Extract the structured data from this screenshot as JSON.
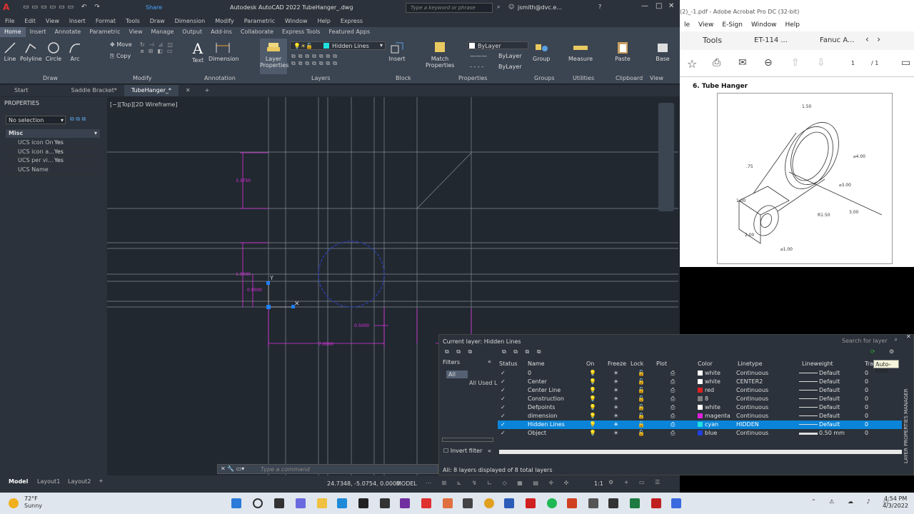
{
  "acad": {
    "title": "Autodesk AutoCAD 2022   TubeHanger_.dwg",
    "search_placeholder": "Type a keyword or phrase",
    "user": "jsmith@dvc.e...",
    "share": "Share",
    "menus": [
      "File",
      "Edit",
      "View",
      "Insert",
      "Format",
      "Tools",
      "Draw",
      "Dimension",
      "Modify",
      "Parametric",
      "Window",
      "Help",
      "Express"
    ],
    "ribbon_tabs": [
      "Home",
      "Insert",
      "Annotate",
      "Parametric",
      "View",
      "Manage",
      "Output",
      "Add-ins",
      "Collaborate",
      "Express Tools",
      "Featured Apps"
    ],
    "draw_tools": [
      "Line",
      "Polyline",
      "Circle",
      "Arc"
    ],
    "modify_tools": [
      "Move",
      "Copy"
    ],
    "annot_tools": [
      "Text",
      "Dimension"
    ],
    "layer_tool": "Layer\nProperties",
    "layer_current": "Hidden Lines",
    "insert_tool": "Insert",
    "match_tool": "Match\nProperties",
    "bylayer": [
      "ByLayer",
      "ByLayer",
      "ByLayer"
    ],
    "group_tool": "Group",
    "measure_tool": "Measure",
    "paste_tool": "Paste",
    "base_tool": "Base",
    "panels": [
      "Draw",
      "Modify",
      "Annotation",
      "Layers",
      "Block",
      "Properties",
      "Groups",
      "Utilities",
      "Clipboard",
      "View"
    ],
    "doc_tabs": [
      "Start",
      "Saddle Bracket*",
      "TubeHanger_*"
    ],
    "viewport_label": "[−][Top][2D Wireframe]",
    "properties": {
      "title": "PROPERTIES",
      "selection": "No selection",
      "section": "Misc",
      "rows": [
        {
          "k": "UCS icon On",
          "v": "Yes"
        },
        {
          "k": "UCS icon a...",
          "v": "Yes"
        },
        {
          "k": "UCS per vi...",
          "v": "Yes"
        },
        {
          "k": "UCS Name",
          "v": ""
        }
      ]
    },
    "dims": [
      "3.3750",
      "1.0000",
      "0.0000",
      "0.5000",
      "7.0000"
    ],
    "command_placeholder": "Type a command",
    "layout_tabs": [
      "Model",
      "Layout1",
      "Layout2"
    ],
    "coords": "24.7348, -5.0754, 0.0000",
    "model": "MODEL",
    "scale": "1:1"
  },
  "acrobat": {
    "title": "(2)_-1.pdf - Adobe Acrobat Pro DC (32-bit)",
    "menus": [
      "le",
      "View",
      "E-Sign",
      "Window",
      "Help"
    ],
    "tabs": [
      "Tools",
      "ET-114 ...",
      "Fanuc A..."
    ],
    "page": "1",
    "pages": "/ 1",
    "heading": "6.  Tube Hanger",
    "drawing_labels": [
      "1.50",
      "⌀4.00",
      "⌀3.00",
      "R1.50",
      "3.00",
      "1.00",
      "2.00",
      "⌀1.00",
      ".75"
    ]
  },
  "lpm": {
    "current_layer": "Current layer: Hidden Lines",
    "search_placeholder": "Search for layer",
    "filters_label": "Filters",
    "tree": [
      "All",
      "All Used L"
    ],
    "invert_filter": "Invert filter",
    "headers": [
      "Status",
      "Name",
      "On",
      "Freeze",
      "Lock",
      "Plot",
      "Color",
      "Linetype",
      "Lineweight",
      "Tran"
    ],
    "layers": [
      {
        "name": "0",
        "color": "white",
        "hex": "#ffffff",
        "linetype": "Continuous",
        "lineweight": "Default",
        "tr": "0"
      },
      {
        "name": "Center",
        "color": "white",
        "hex": "#ffffff",
        "linetype": "CENTER2",
        "lineweight": "Default",
        "tr": "0"
      },
      {
        "name": "Center Line",
        "color": "red",
        "hex": "#e02020",
        "linetype": "Continuous",
        "lineweight": "Default",
        "tr": "0"
      },
      {
        "name": "Construction",
        "color": "8",
        "hex": "#808080",
        "linetype": "Continuous",
        "lineweight": "Default",
        "tr": "0"
      },
      {
        "name": "Defpoints",
        "color": "white",
        "hex": "#ffffff",
        "linetype": "Continuous",
        "lineweight": "Default",
        "tr": "0"
      },
      {
        "name": "dimension",
        "color": "magenta",
        "hex": "#e020e0",
        "linetype": "Continuous",
        "lineweight": "Default",
        "tr": "0"
      },
      {
        "name": "Hidden Lines",
        "color": "cyan",
        "hex": "#20e0e0",
        "linetype": "HIDDEN",
        "lineweight": "Default",
        "tr": "0"
      },
      {
        "name": "Object",
        "color": "blue",
        "hex": "#2040e0",
        "linetype": "Continuous",
        "lineweight": "0.50 mm",
        "tr": "0"
      }
    ],
    "status_text": "All: 8 layers displayed of 8 total layers",
    "tooltip": "Auto-hide",
    "side_title": "LAYER PROPERTIES MANAGER"
  },
  "taskbar": {
    "temp": "72°F",
    "weather": "Sunny",
    "time": "4:54 PM",
    "date": "4/3/2022"
  }
}
